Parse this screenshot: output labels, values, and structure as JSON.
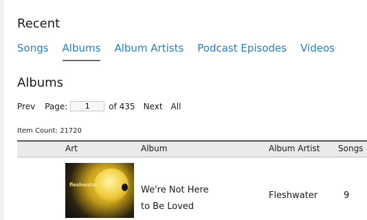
{
  "recent": {
    "title": "Recent"
  },
  "tabs": [
    {
      "label": "Songs",
      "active": false
    },
    {
      "label": "Albums",
      "active": true
    },
    {
      "label": "Album Artists",
      "active": false
    },
    {
      "label": "Podcast Episodes",
      "active": false
    },
    {
      "label": "Videos",
      "active": false
    }
  ],
  "albums": {
    "title": "Albums",
    "pager": {
      "prev": "Prev",
      "page_label": "Page:",
      "page_value": "1",
      "of_total": "of 435",
      "next": "Next",
      "all": "All"
    },
    "item_count": "Item Count: 21720"
  },
  "table": {
    "headers": {
      "art": "Art",
      "album": "Album",
      "album_artist": "Album Artist",
      "songs": "Songs"
    },
    "rows": [
      {
        "album": "We're Not Here to Be Loved",
        "album_artist": "Fleshwater",
        "songs": "9",
        "cover_text": "fleshwater"
      }
    ]
  },
  "colors": {
    "link": "#1f7fc3",
    "header_bg": "#eaeaea"
  }
}
